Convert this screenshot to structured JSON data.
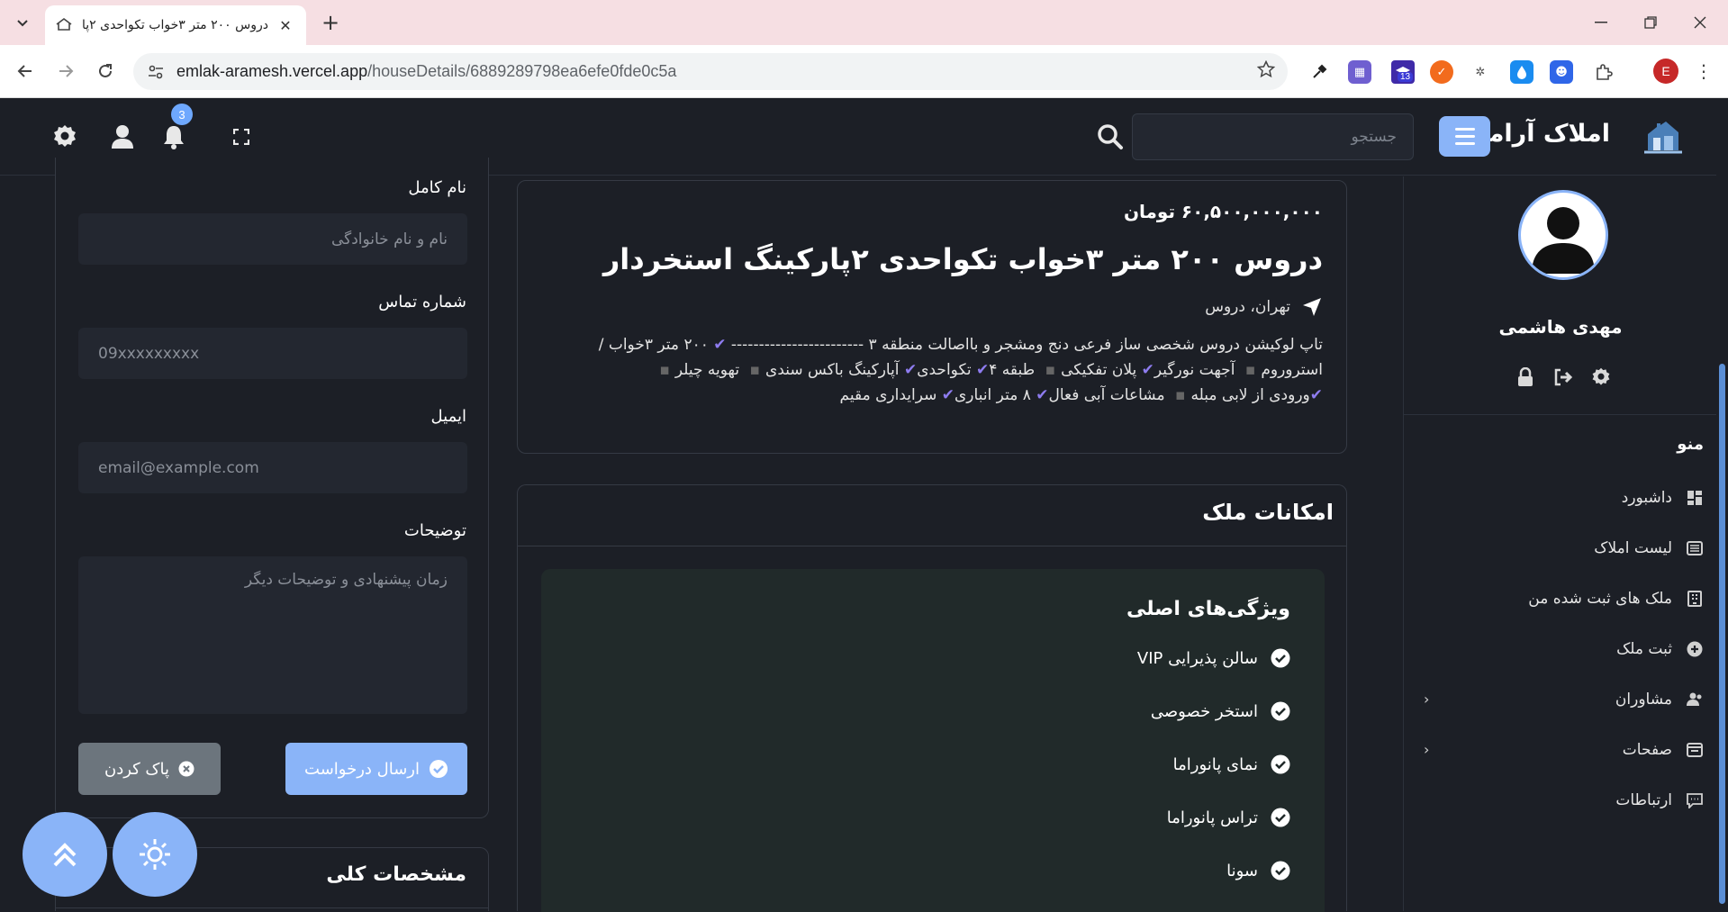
{
  "browser": {
    "tab_title": "دروس ۲۰۰ متر ۳خواب تکواحدی ۲پا",
    "url_host": "emlak-aramesh.vercel.app",
    "url_path": "/houseDetails/6889289798ea6efe0fde0c5a",
    "profile_initial": "E",
    "ext_badge": "13"
  },
  "header": {
    "app_name": "املاک آرامش",
    "search_placeholder": "جستجو",
    "notification_count": "3"
  },
  "sidebar": {
    "user_name": "مهدی هاشمی",
    "menu_title": "منو",
    "items": [
      {
        "label": "داشبورد",
        "icon": "dashboard-icon"
      },
      {
        "label": "لیست املاک",
        "icon": "list-icon"
      },
      {
        "label": "ملک های ثبت شده من",
        "icon": "building-icon"
      },
      {
        "label": "ثبت ملک",
        "icon": "plus-circle-icon"
      },
      {
        "label": "مشاوران",
        "icon": "users-icon"
      },
      {
        "label": "صفحات",
        "icon": "pages-icon"
      },
      {
        "label": "ارتباطات",
        "icon": "chat-icon"
      }
    ]
  },
  "property": {
    "price": "۶۰,۵۰۰,۰۰۰,۰۰۰ تومان",
    "title": "دروس ۲۰۰ متر ۳خواب تکواحدی ۲پارکینگ استخردار",
    "location": "تهران، دروس",
    "desc_line1": "تاپ لوکیشن دروس شخصی ساز فرعی دنج ومشجر و بااصالت منطقه ۳ ------------------------",
    "desc_line1_b": "۲۰۰ متر ۳خواب /",
    "desc_line2_a": "استروروم",
    "desc_line2_b": "آجهت نورگیر",
    "desc_line2_c": "پلان تفکیکی",
    "desc_line2_d": "طبقه ۴",
    "desc_line2_e": "تکواحدی",
    "desc_line2_f": "آپارکینگ باکس سندی",
    "desc_line2_g": "تهویه چیلر",
    "desc_line3_a": "ورودی از لابی مبله",
    "desc_line3_b": "مشاعات آبی فعال",
    "desc_line3_c": "۸ متر انباری",
    "desc_line3_d": "سرایداری مقیم"
  },
  "amenities": {
    "section_title": "امکانات ملک",
    "group_title": "ویژگی‌های اصلی",
    "features": [
      "سالن پذیرایی VIP",
      "استخر خصوصی",
      "نمای پانوراما",
      "تراس پانوراما",
      "سونا"
    ]
  },
  "form": {
    "fullname_label": "نام کامل",
    "fullname_placeholder": "نام و نام خانوادگی",
    "phone_label": "شماره تماس",
    "phone_placeholder": "09xxxxxxxxx",
    "email_label": "ایمیل",
    "email_placeholder": "email@example.com",
    "notes_label": "توضیحات",
    "notes_placeholder": "زمان پیشنهادی و توضیحات دیگر",
    "submit_label": "ارسال درخواست",
    "clear_label": "پاک کردن"
  },
  "specs": {
    "title": "مشخصات کلی"
  },
  "colors": {
    "accent": "#8ab4f8",
    "background": "#1c1f26",
    "check_purple": "#8e7cf0"
  }
}
